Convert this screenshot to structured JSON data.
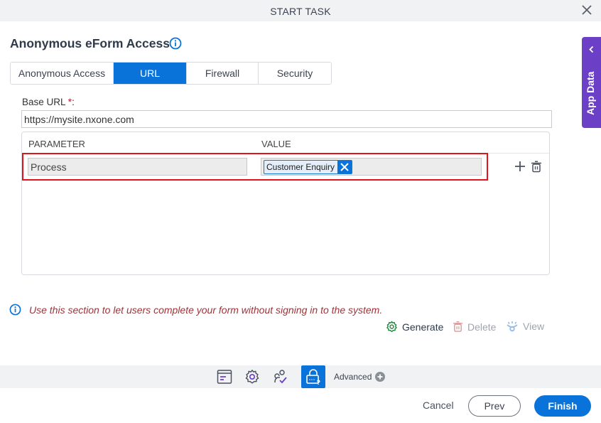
{
  "window": {
    "title": "START TASK"
  },
  "header": {
    "title": "Anonymous eForm Access"
  },
  "tabs": [
    {
      "label": "Anonymous Access",
      "active": false
    },
    {
      "label": "URL",
      "active": true
    },
    {
      "label": "Firewall",
      "active": false
    },
    {
      "label": "Security",
      "active": false
    }
  ],
  "form": {
    "base_url_label": "Base URL",
    "required_marker": "*",
    "label_suffix": ":",
    "base_url_value": "https://mysite.nxone.com"
  },
  "grid": {
    "columns": [
      "PARAMETER",
      "VALUE"
    ],
    "rows": [
      {
        "parameter": "Process",
        "value_tokens": [
          "Customer Enquiry"
        ]
      }
    ]
  },
  "side_panel": {
    "label": "App Data"
  },
  "note": {
    "text": "Use this section to let users complete your form without signing in to the system."
  },
  "actions": {
    "generate": "Generate",
    "delete": "Delete",
    "view": "View"
  },
  "bottom_toolbar": {
    "advanced_label": "Advanced"
  },
  "footer": {
    "cancel": "Cancel",
    "prev": "Prev",
    "finish": "Finish"
  },
  "colors": {
    "accent": "#0a73d9",
    "side_panel": "#6b3fc6",
    "highlight": "#e0141a",
    "note_text": "#9c3338",
    "generate_icon": "#1f8a3a"
  }
}
